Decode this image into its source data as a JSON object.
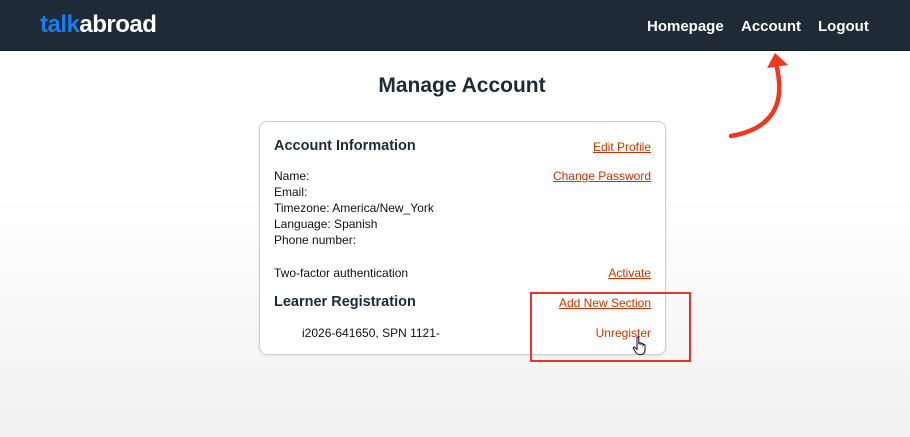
{
  "brand": {
    "part1": "talk",
    "part2": "abroad"
  },
  "nav": {
    "homepage": "Homepage",
    "account": "Account",
    "logout": "Logout"
  },
  "page": {
    "title": "Manage Account"
  },
  "account_info": {
    "heading": "Account Information",
    "edit_profile": "Edit Profile",
    "change_password": "Change Password",
    "fields": {
      "name": "Name:",
      "email": "Email:",
      "timezone": "Timezone: America/New_York",
      "language": "Language: Spanish",
      "phone": "Phone number:"
    },
    "two_factor_label": "Two-factor authentication",
    "activate": "Activate"
  },
  "learner_registration": {
    "heading": "Learner Registration",
    "add_section": "Add New Section",
    "section_text": "i2026-641650, SPN 1121-",
    "unregister": "Unregister"
  },
  "colors": {
    "navbar": "#1e2a36",
    "brand_blue": "#1a7cf0",
    "link": "#cc3300",
    "annotation": "#e8342a"
  }
}
